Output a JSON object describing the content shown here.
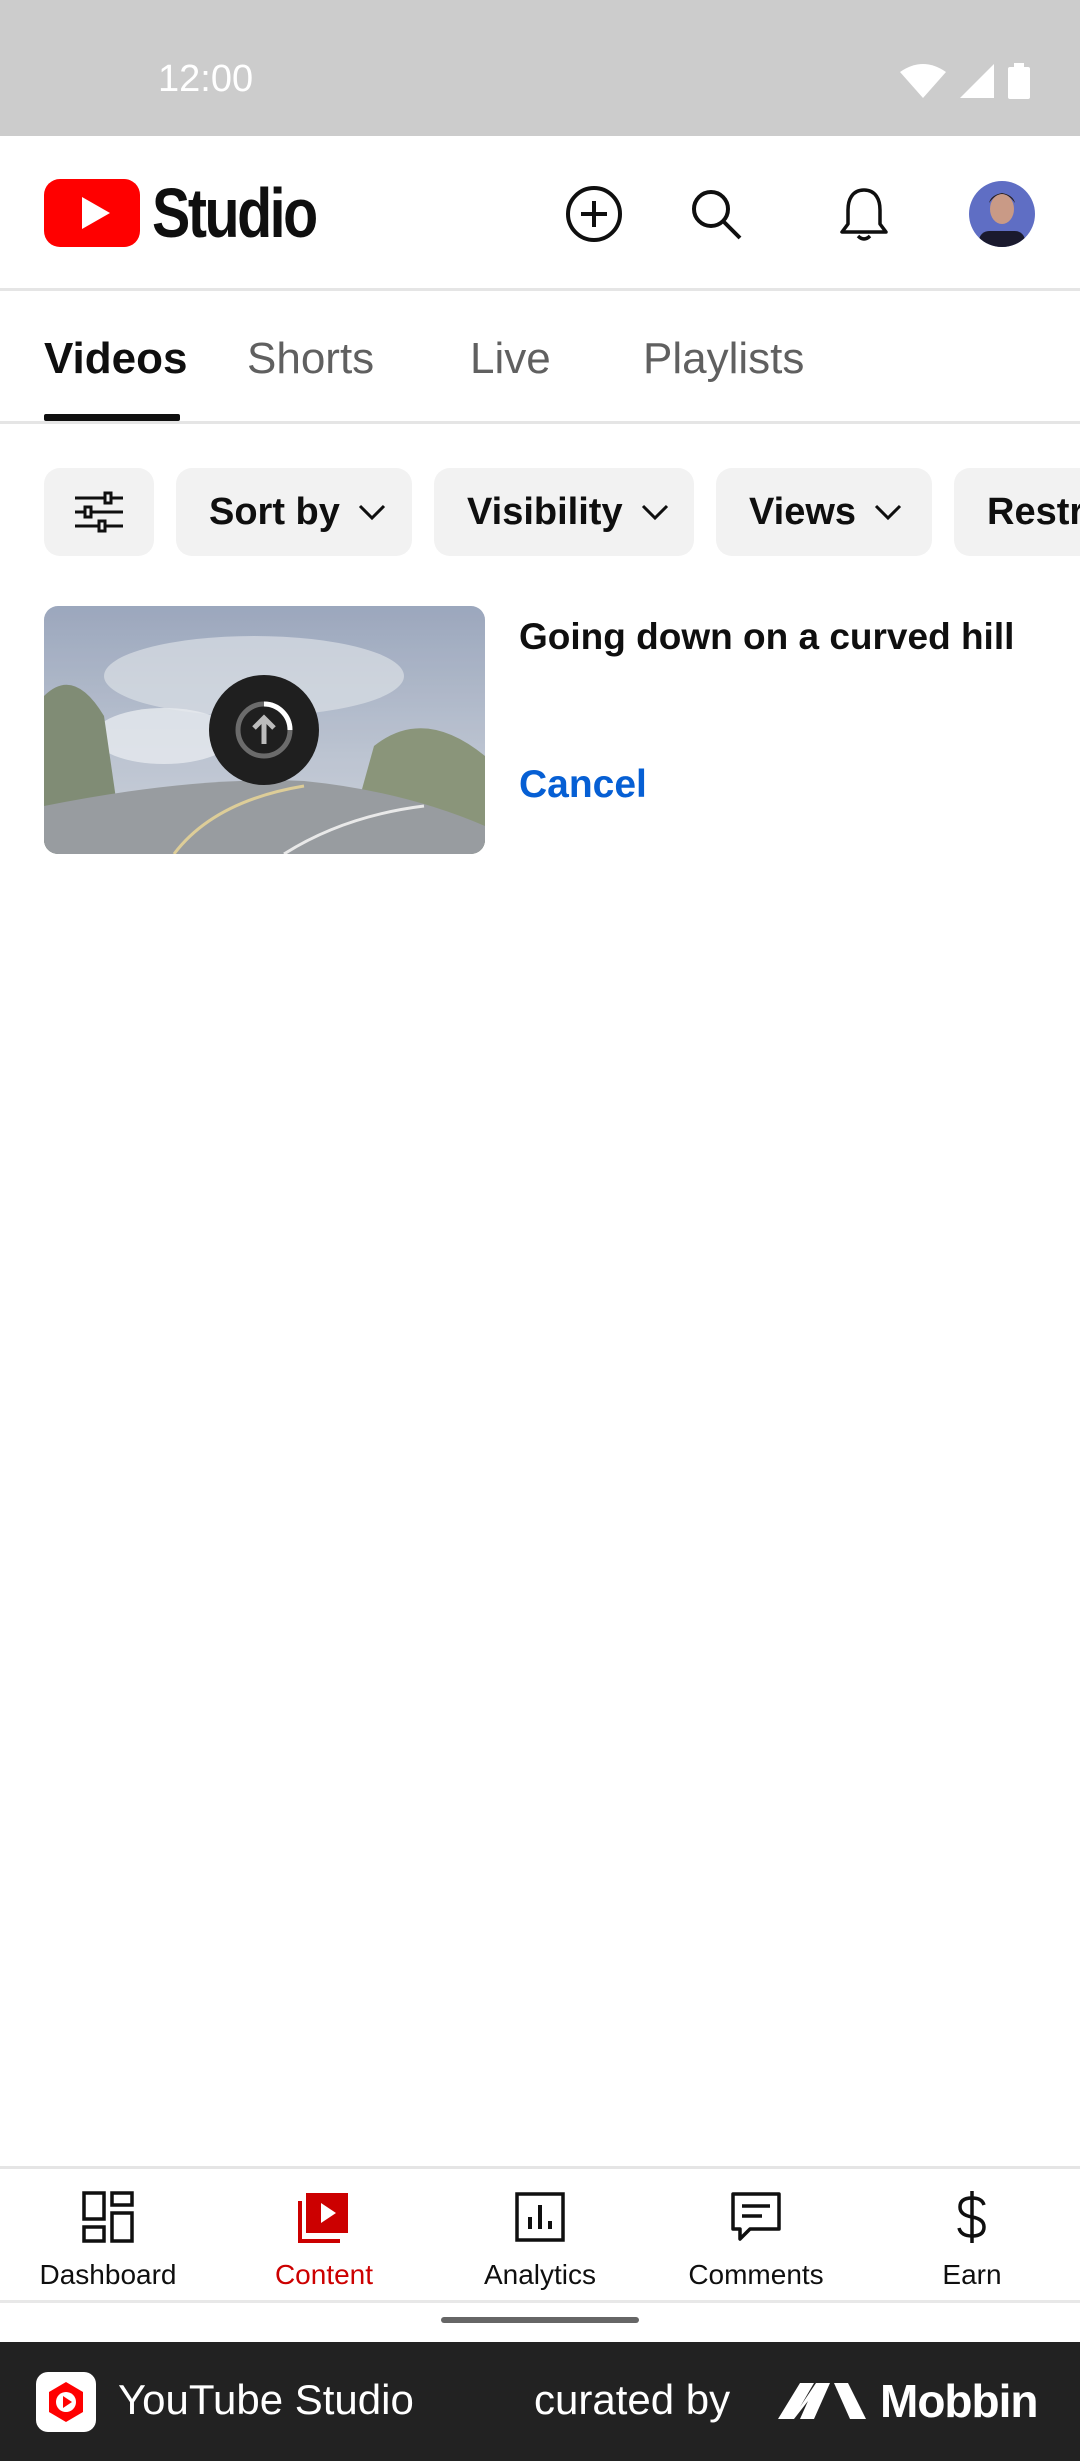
{
  "status_bar": {
    "time": "12:00",
    "icons": [
      "wifi-icon",
      "cellular-signal-icon",
      "battery-icon"
    ]
  },
  "header": {
    "logo_text": "Studio",
    "actions": [
      "create-icon",
      "search-icon",
      "notifications-icon",
      "avatar"
    ]
  },
  "tabs": [
    {
      "label": "Videos",
      "active": true
    },
    {
      "label": "Shorts",
      "active": false
    },
    {
      "label": "Live",
      "active": false
    },
    {
      "label": "Playlists",
      "active": false
    }
  ],
  "filters": {
    "filter_icon": "sliders-icon",
    "chips": [
      "Sort by",
      "Visibility",
      "Views",
      "Restr"
    ]
  },
  "videos": [
    {
      "title": "Going down on a curved hill",
      "status_icon": "upload-progress-icon",
      "action_label": "Cancel"
    }
  ],
  "bottom_nav": [
    {
      "label": "Dashboard",
      "icon": "dashboard-icon",
      "active": false
    },
    {
      "label": "Content",
      "icon": "content-icon",
      "active": true
    },
    {
      "label": "Analytics",
      "icon": "analytics-icon",
      "active": false
    },
    {
      "label": "Comments",
      "icon": "comments-icon",
      "active": false
    },
    {
      "label": "Earn",
      "icon": "dollar-icon",
      "active": false
    }
  ],
  "banner": {
    "app_name": "YouTube Studio",
    "curated_by": "curated by",
    "brand": "Mobbin"
  },
  "colors": {
    "brand_red": "#ff0000",
    "active_nav": "#cc0000",
    "link_blue": "#065fd4",
    "chip_bg": "#f2f2f2"
  }
}
